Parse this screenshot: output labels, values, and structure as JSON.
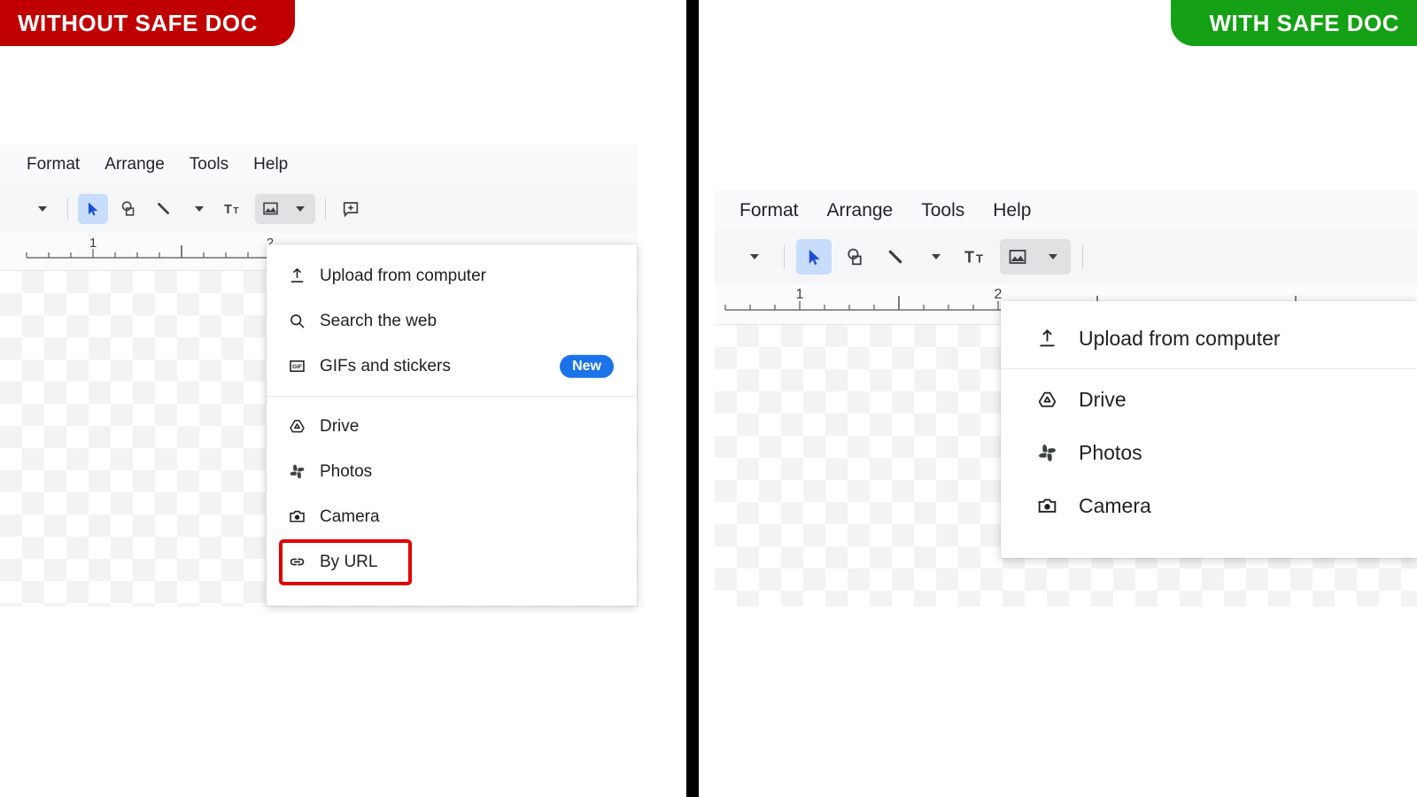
{
  "banners": {
    "left": {
      "label": "WITHOUT SAFE DOC",
      "color": "#c00000"
    },
    "right": {
      "label": "WITH SAFE DOC",
      "color": "#15a115"
    }
  },
  "divider": {
    "color": "#000000"
  },
  "left_panel": {
    "menubar": [
      {
        "label": "Format"
      },
      {
        "label": "Arrange"
      },
      {
        "label": "Tools"
      },
      {
        "label": "Help"
      }
    ],
    "toolbar": [
      {
        "icon": "chevron-down-icon",
        "name": "toolbar-overflow-caret"
      },
      {
        "icon": "separator",
        "name": "toolbar-separator-1"
      },
      {
        "icon": "cursor-select-icon",
        "name": "toolbar-select-tool",
        "state": "selected-blue"
      },
      {
        "icon": "shape-icon",
        "name": "toolbar-shape-tool"
      },
      {
        "icon": "line-icon",
        "name": "toolbar-line-tool"
      },
      {
        "icon": "chevron-down-icon",
        "name": "toolbar-line-caret"
      },
      {
        "icon": "text-box-icon",
        "name": "toolbar-text-tool"
      },
      {
        "icon": "image-icon",
        "name": "toolbar-image-tool",
        "state": "selected-grey"
      },
      {
        "icon": "chevron-down-icon",
        "name": "toolbar-image-caret",
        "state": "selected-grey"
      },
      {
        "icon": "separator",
        "name": "toolbar-separator-2"
      },
      {
        "icon": "comment-add-icon",
        "name": "toolbar-comment-tool"
      }
    ],
    "ruler": {
      "labels": [
        "1",
        "2"
      ]
    },
    "image_menu": {
      "groups": [
        {
          "items": [
            {
              "label": "Upload from computer",
              "icon": "upload-icon",
              "badge": null,
              "highlighted": false
            },
            {
              "label": "Search the web",
              "icon": "search-icon",
              "badge": null,
              "highlighted": false
            },
            {
              "label": "GIFs and stickers",
              "icon": "gif-icon",
              "badge": "New",
              "highlighted": false
            }
          ]
        },
        {
          "items": [
            {
              "label": "Drive",
              "icon": "drive-icon",
              "badge": null,
              "highlighted": false
            },
            {
              "label": "Photos",
              "icon": "photos-icon",
              "badge": null,
              "highlighted": false
            },
            {
              "label": "Camera",
              "icon": "camera-icon",
              "badge": null,
              "highlighted": false
            },
            {
              "label": "By URL",
              "icon": "link-icon",
              "badge": null,
              "highlighted": true
            }
          ]
        }
      ],
      "highlight_color": "#e00000",
      "badge_color": "#1a73e8"
    }
  },
  "right_panel": {
    "menubar": [
      {
        "label": "Format"
      },
      {
        "label": "Arrange"
      },
      {
        "label": "Tools"
      },
      {
        "label": "Help"
      }
    ],
    "toolbar": [
      {
        "icon": "chevron-down-icon",
        "name": "toolbar-overflow-caret"
      },
      {
        "icon": "separator",
        "name": "toolbar-separator-1"
      },
      {
        "icon": "cursor-select-icon",
        "name": "toolbar-select-tool",
        "state": "selected-blue"
      },
      {
        "icon": "shape-icon",
        "name": "toolbar-shape-tool"
      },
      {
        "icon": "line-icon",
        "name": "toolbar-line-tool"
      },
      {
        "icon": "chevron-down-icon",
        "name": "toolbar-line-caret"
      },
      {
        "icon": "text-box-icon",
        "name": "toolbar-text-tool"
      },
      {
        "icon": "image-icon",
        "name": "toolbar-image-tool",
        "state": "selected-grey"
      },
      {
        "icon": "chevron-down-icon",
        "name": "toolbar-image-caret",
        "state": "selected-grey"
      },
      {
        "icon": "separator",
        "name": "toolbar-separator-2"
      }
    ],
    "ruler": {
      "labels": [
        "1",
        "2"
      ]
    },
    "image_menu": {
      "groups": [
        {
          "items": [
            {
              "label": "Upload from computer",
              "icon": "upload-icon",
              "badge": null,
              "highlighted": false
            }
          ]
        },
        {
          "items": [
            {
              "label": "Drive",
              "icon": "drive-icon",
              "badge": null,
              "highlighted": false
            },
            {
              "label": "Photos",
              "icon": "photos-icon",
              "badge": null,
              "highlighted": false
            },
            {
              "label": "Camera",
              "icon": "camera-icon",
              "badge": null,
              "highlighted": false
            }
          ]
        }
      ]
    }
  }
}
